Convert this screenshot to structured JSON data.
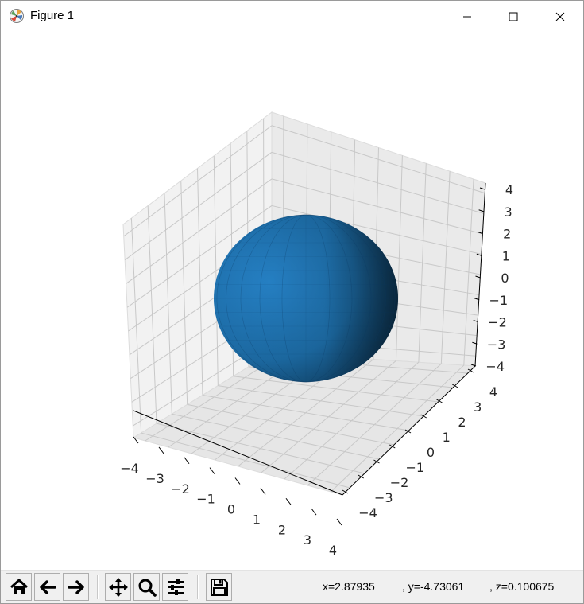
{
  "window": {
    "title": "Figure 1",
    "icons": {
      "app": "matplotlib-icon",
      "minimize": "minimize-icon",
      "maximize": "maximize-icon",
      "close": "close-icon"
    }
  },
  "plot": {
    "type": "3d-surface",
    "surface": "sphere",
    "surface_color": "#1f77b4",
    "x_ticks": [
      "−4",
      "−3",
      "−2",
      "−1",
      "0",
      "1",
      "2",
      "3",
      "4"
    ],
    "y_ticks": [
      "−4",
      "−3",
      "−2",
      "−1",
      "0",
      "1",
      "2",
      "3",
      "4"
    ],
    "z_ticks": [
      "4",
      "3",
      "2",
      "1",
      "0",
      "−1",
      "−2",
      "−3",
      "−4"
    ],
    "xlim": [
      -4,
      4
    ],
    "ylim": [
      -4,
      4
    ],
    "zlim": [
      -4,
      4
    ],
    "grid": true
  },
  "toolbar": {
    "buttons": [
      {
        "name": "home-button",
        "icon": "home-icon"
      },
      {
        "name": "back-button",
        "icon": "arrow-left-icon"
      },
      {
        "name": "forward-button",
        "icon": "arrow-right-icon"
      },
      {
        "name": "pan-button",
        "icon": "move-icon"
      },
      {
        "name": "zoom-button",
        "icon": "magnifier-icon"
      },
      {
        "name": "configure-subplots-button",
        "icon": "sliders-icon"
      },
      {
        "name": "save-button",
        "icon": "floppy-icon"
      }
    ],
    "coords": {
      "x": "x=2.87935",
      "y": ", y=-4.73061",
      "z": ", z=0.100675"
    }
  }
}
